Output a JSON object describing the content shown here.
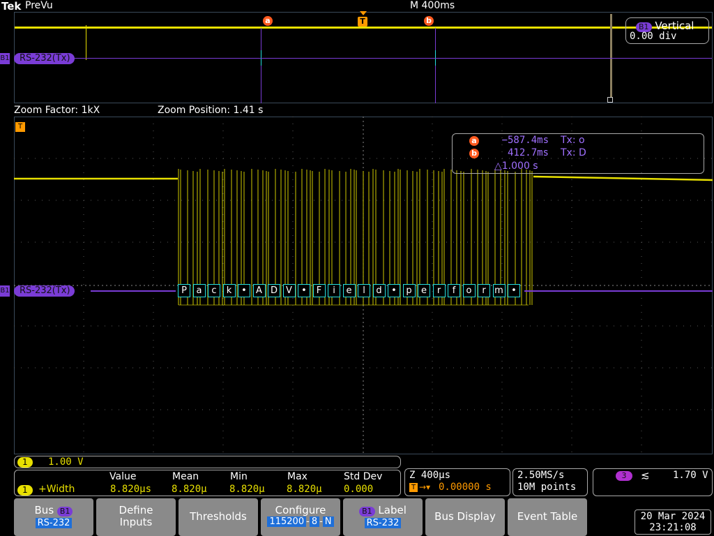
{
  "header": {
    "brand": "Tek",
    "mode": "PreVu",
    "timebase": "M 400ms"
  },
  "bus": {
    "tag": "B1",
    "label": "RS-232(Tx)"
  },
  "markers": {
    "a": "a",
    "b": "b",
    "trigger": "T"
  },
  "vertical": {
    "title": "Vertical",
    "value": "0.00 div"
  },
  "zoom": {
    "factor": "Zoom Factor: 1kX",
    "position": "Zoom Position: 1.41 s"
  },
  "cursors": {
    "a_time": "−587.4ms",
    "a_data": "Tx: o",
    "b_time": "412.7ms",
    "b_data": "Tx: D",
    "delta": "△1.000 s"
  },
  "decoded_chars": [
    "P",
    "a",
    "c",
    "k",
    "•",
    "A",
    "D",
    "V",
    "•",
    "F",
    "i",
    "e",
    "l",
    "d",
    "•",
    "p",
    "e",
    "r",
    "f",
    "o",
    "r",
    "m",
    "•"
  ],
  "channel1": {
    "num": "1",
    "scale": "1.00 V"
  },
  "measurement": {
    "label": "+Width",
    "headers": [
      "Value",
      "Mean",
      "Min",
      "Max",
      "Std Dev"
    ],
    "values": [
      "8.820µs",
      "8.820µ",
      "8.820µ",
      "8.820µ",
      "0.000"
    ]
  },
  "zoom_readout": {
    "z": "Z 400µs",
    "trig_offset": "0.00000 s"
  },
  "acq": {
    "rate": "2.50MS/s",
    "points": "10M points"
  },
  "trigger": {
    "source": "3",
    "slope": "≲",
    "level": "1.70 V"
  },
  "buttons": {
    "bus": {
      "l1": "Bus",
      "l2": "RS-232"
    },
    "define": {
      "l1": "Define",
      "l2": "Inputs"
    },
    "thresholds": "Thresholds",
    "configure": {
      "l1": "Configure",
      "v1": "115200",
      "v2": "8",
      "v3": "N"
    },
    "label": {
      "l1": "Label",
      "l2": "RS-232"
    },
    "bus_display": "Bus Display",
    "event_table": "Event Table"
  },
  "datetime": {
    "date": "20 Mar 2024",
    "time": "23:21:08"
  },
  "colors": {
    "ch1": "#e8e000",
    "bus": "#7a3cd6",
    "cursor": "#ff5a1f",
    "decode_box": "#25e0e0"
  }
}
